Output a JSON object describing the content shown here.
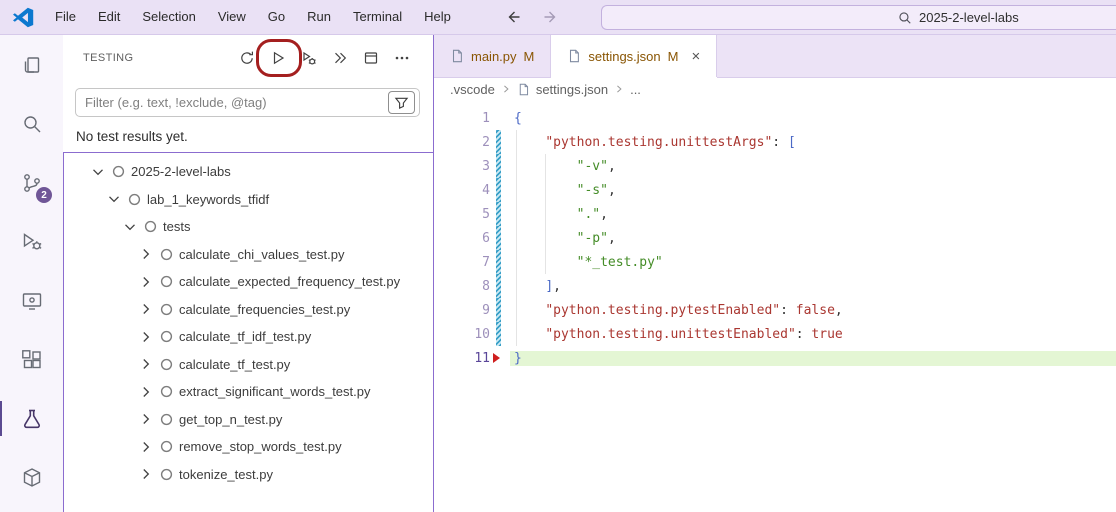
{
  "title_bar": {
    "menus": [
      "File",
      "Edit",
      "Selection",
      "View",
      "Go",
      "Run",
      "Terminal",
      "Help"
    ],
    "search_value": "2025-2-level-labs"
  },
  "activity_bar": {
    "badge": "2",
    "items": [
      "explorer",
      "search",
      "source-control",
      "run-and-debug",
      "remote-explorer",
      "extensions",
      "testing",
      "package"
    ],
    "active_item": "testing"
  },
  "sidebar": {
    "title": "TESTING",
    "toolbar": [
      "refresh-tests",
      "run-tests",
      "debug-tests",
      "coverage-tests",
      "show-output",
      "more-actions"
    ],
    "filter_placeholder": "Filter (e.g. text, !exclude, @tag)",
    "status": "No test results yet.",
    "tree": [
      {
        "label": "2025-2-level-labs",
        "level": 0,
        "expanded": true
      },
      {
        "label": "lab_1_keywords_tfidf",
        "level": 1,
        "expanded": true
      },
      {
        "label": "tests",
        "level": 2,
        "expanded": true
      },
      {
        "label": "calculate_chi_values_test.py",
        "level": 3,
        "expanded": false
      },
      {
        "label": "calculate_expected_frequency_test.py",
        "level": 3,
        "expanded": false
      },
      {
        "label": "calculate_frequencies_test.py",
        "level": 3,
        "expanded": false
      },
      {
        "label": "calculate_tf_idf_test.py",
        "level": 3,
        "expanded": false
      },
      {
        "label": "calculate_tf_test.py",
        "level": 3,
        "expanded": false
      },
      {
        "label": "extract_significant_words_test.py",
        "level": 3,
        "expanded": false
      },
      {
        "label": "get_top_n_test.py",
        "level": 3,
        "expanded": false
      },
      {
        "label": "remove_stop_words_test.py",
        "level": 3,
        "expanded": false
      },
      {
        "label": "tokenize_test.py",
        "level": 3,
        "expanded": false
      }
    ]
  },
  "editor": {
    "tabs": [
      {
        "label": "main.py",
        "modified": "M",
        "active": false
      },
      {
        "label": "settings.json",
        "modified": "M",
        "active": true,
        "close": "×"
      }
    ],
    "breadcrumbs": [
      ".vscode",
      "settings.json",
      "..."
    ],
    "code": {
      "language": "json",
      "lines": [
        {
          "n": 1,
          "tokens": [
            [
              "brace",
              "{"
            ]
          ]
        },
        {
          "n": 2,
          "modified": true,
          "tokens": [
            [
              "plain",
              "    "
            ],
            [
              "key",
              "\"python.testing.unittestArgs\""
            ],
            [
              "plain",
              ": "
            ],
            [
              "brace",
              "["
            ]
          ]
        },
        {
          "n": 3,
          "modified": true,
          "tokens": [
            [
              "plain",
              "        "
            ],
            [
              "str",
              "\"-v\""
            ],
            [
              "plain",
              ","
            ]
          ]
        },
        {
          "n": 4,
          "modified": true,
          "tokens": [
            [
              "plain",
              "        "
            ],
            [
              "str",
              "\"-s\""
            ],
            [
              "plain",
              ","
            ]
          ]
        },
        {
          "n": 5,
          "modified": true,
          "tokens": [
            [
              "plain",
              "        "
            ],
            [
              "str",
              "\".\""
            ],
            [
              "plain",
              ","
            ]
          ]
        },
        {
          "n": 6,
          "modified": true,
          "tokens": [
            [
              "plain",
              "        "
            ],
            [
              "str",
              "\"-p\""
            ],
            [
              "plain",
              ","
            ]
          ]
        },
        {
          "n": 7,
          "modified": true,
          "tokens": [
            [
              "plain",
              "        "
            ],
            [
              "str",
              "\"*_test.py\""
            ]
          ]
        },
        {
          "n": 8,
          "modified": true,
          "tokens": [
            [
              "plain",
              "    "
            ],
            [
              "brace",
              "]"
            ],
            [
              "plain",
              ","
            ]
          ]
        },
        {
          "n": 9,
          "modified": true,
          "tokens": [
            [
              "plain",
              "    "
            ],
            [
              "key",
              "\"python.testing.pytestEnabled\""
            ],
            [
              "plain",
              ": "
            ],
            [
              "bool",
              "false"
            ],
            [
              "plain",
              ","
            ]
          ]
        },
        {
          "n": 10,
          "modified": true,
          "tokens": [
            [
              "plain",
              "    "
            ],
            [
              "key",
              "\"python.testing.unittestEnabled\""
            ],
            [
              "plain",
              ": "
            ],
            [
              "bool",
              "true"
            ]
          ]
        },
        {
          "n": 11,
          "highlight": true,
          "marker": true,
          "tokens": [
            [
              "brace",
              "}"
            ]
          ]
        }
      ]
    }
  },
  "colors": {
    "titlebar_background": "#EAE1F5",
    "modified_file": "#895503",
    "json_key": "#AA3731",
    "json_string": "#448C27",
    "line_highlight": "#E4F6D4",
    "focus_border": "#8B6CCF",
    "badge_background": "#705697",
    "annotation_red": "#A41F1F"
  }
}
